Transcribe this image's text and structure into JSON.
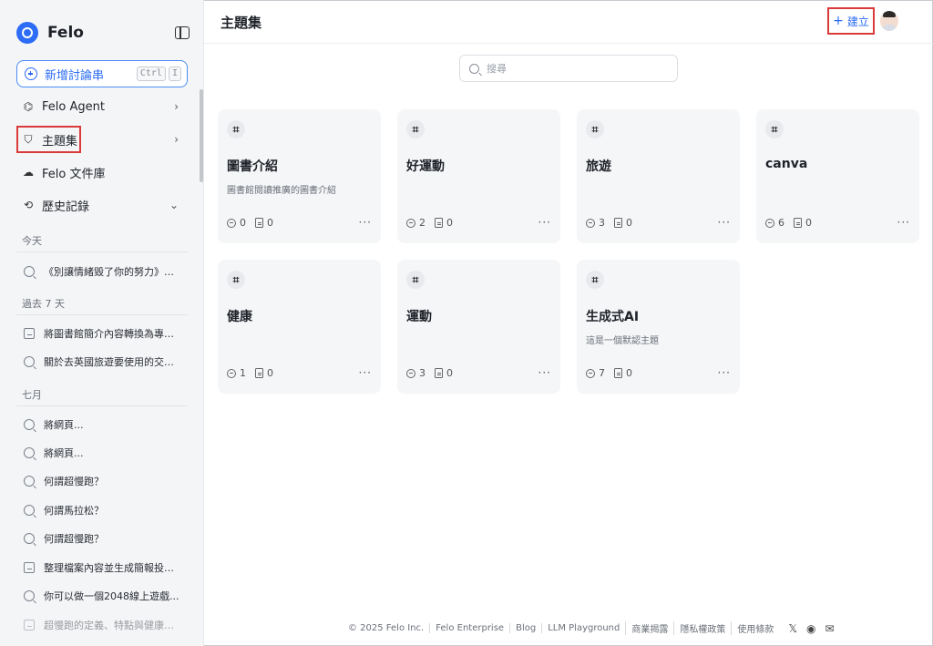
{
  "app": {
    "name": "Felo"
  },
  "sidebar": {
    "new_thread_label": "新增討論串",
    "shortcut_keys": [
      "Ctrl",
      "I"
    ],
    "nav": [
      {
        "label": "Felo Agent",
        "icon": "agent-icon",
        "chevron": "›"
      },
      {
        "label": "主題集",
        "icon": "bookmark-icon",
        "chevron": "›"
      },
      {
        "label": "Felo 文件庫",
        "icon": "cloud-upload-icon",
        "chevron": ""
      },
      {
        "label": "歷史記錄",
        "icon": "history-icon",
        "chevron": "⌄"
      }
    ],
    "sections": [
      {
        "label": "今天",
        "items": [
          {
            "text": "《別讓情緒毀了你的努力》書...",
            "icon": "search-icon"
          }
        ]
      },
      {
        "label": "過去 7 天",
        "items": [
          {
            "text": "將圖書館簡介內容轉換為專業...",
            "icon": "slides-icon"
          },
          {
            "text": "關於去英國旅遊要使用的交通...",
            "icon": "search-icon"
          }
        ]
      },
      {
        "label": "七月",
        "items": [
          {
            "text": "將網頁...",
            "icon": "search-icon"
          },
          {
            "text": "將網頁...",
            "icon": "search-icon"
          },
          {
            "text": "何謂超慢跑？",
            "icon": "search-icon"
          },
          {
            "text": "何謂馬拉松？",
            "icon": "search-icon"
          },
          {
            "text": "何謂超慢跑？",
            "icon": "search-icon"
          },
          {
            "text": "整理檔案內容並生成簡報投影...",
            "icon": "doc-icon"
          },
          {
            "text": "你可以做一個2048線上遊戲...",
            "icon": "search-icon"
          },
          {
            "text": "超慢跑的定義、特點與健康效...",
            "icon": "doc-icon"
          }
        ]
      }
    ]
  },
  "header": {
    "title": "主題集",
    "create_label": "建立",
    "create_plus": "+"
  },
  "search": {
    "placeholder": "搜尋"
  },
  "topics": [
    {
      "title": "圖書介紹",
      "desc": "圖書館閱讀推廣的圖書介紹",
      "threads": "0",
      "docs": "0"
    },
    {
      "title": "好運動",
      "desc": "",
      "threads": "2",
      "docs": "0"
    },
    {
      "title": "旅遊",
      "desc": "",
      "threads": "3",
      "docs": "0"
    },
    {
      "title": "canva",
      "desc": "",
      "threads": "6",
      "docs": "0"
    },
    {
      "title": "健康",
      "desc": "",
      "threads": "1",
      "docs": "0"
    },
    {
      "title": "運動",
      "desc": "",
      "threads": "3",
      "docs": "0"
    },
    {
      "title": "生成式AI",
      "desc": "這是一個默認主題",
      "threads": "7",
      "docs": "0"
    }
  ],
  "card_glyphs": {
    "hash": "⌗",
    "more": "···"
  },
  "footer": {
    "links": [
      "© 2025 Felo Inc.",
      "Felo Enterprise",
      "Blog",
      "LLM Playground",
      "商業揭露",
      "隱私權政策",
      "使用條款"
    ],
    "social_icons": [
      "x-icon",
      "discord-icon",
      "mail-icon"
    ],
    "social_glyphs": [
      "𝕏",
      "◉",
      "✉"
    ]
  },
  "colors": {
    "accent": "#2c6cf6",
    "highlight": "#d93a3a",
    "sidebar_bg": "#f4f5f7",
    "card_bg": "#f5f6f8"
  }
}
